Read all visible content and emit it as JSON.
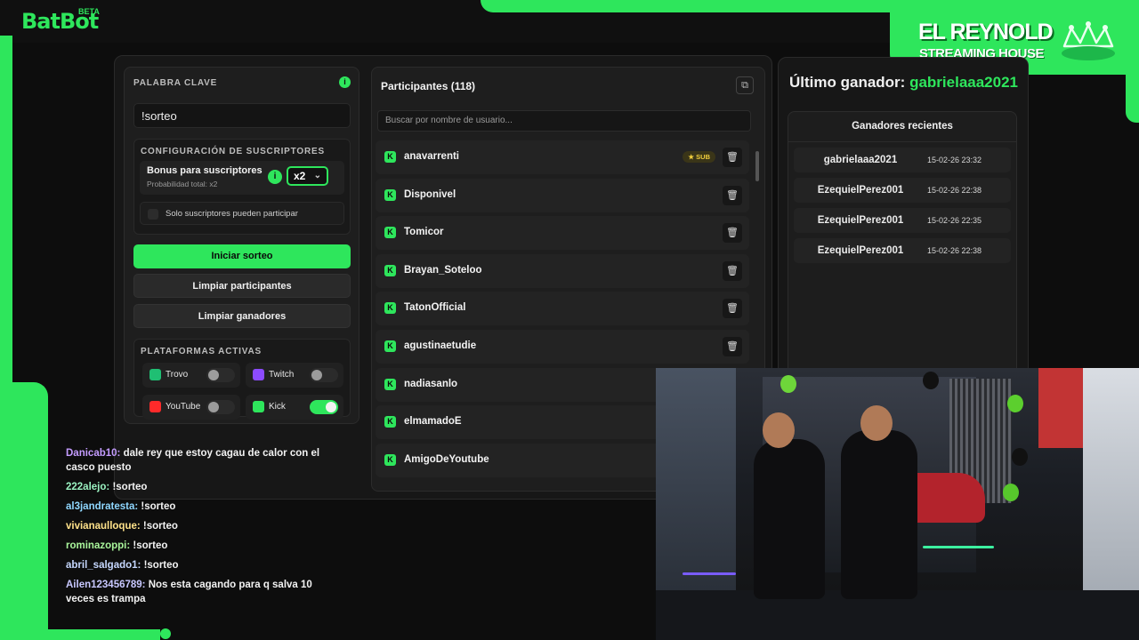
{
  "logo": {
    "text": "BatBot",
    "beta": "BETA"
  },
  "brand": {
    "line1": "EL REYNOLD",
    "line2": "STREAMING HOUSE",
    "crown_icon": "crown-icon"
  },
  "colors": {
    "accent": "#2ee65c",
    "sub_badge": "#f2cf3d"
  },
  "keyword": {
    "label": "PALABRA CLAVE",
    "value": "!sorteo"
  },
  "subs": {
    "label": "CONFIGURACIÓN DE SUSCRIPTORES",
    "bonus_title": "Bonus para suscriptores",
    "bonus_note": "Probabilidad total: x2",
    "multiplier": "x2",
    "only_subs": "Solo suscriptores pueden participar"
  },
  "actions": {
    "start": "Iniciar sorteo",
    "clear_participants": "Limpiar participantes",
    "clear_winners": "Limpiar ganadores"
  },
  "platforms": {
    "label": "PLATAFORMAS ACTIVAS",
    "items": [
      {
        "name": "Trovo",
        "enabled": false
      },
      {
        "name": "Twitch",
        "enabled": false
      },
      {
        "name": "YouTube",
        "enabled": false
      },
      {
        "name": "Kick",
        "enabled": true
      }
    ]
  },
  "participants": {
    "title": "Participantes (118)",
    "search_placeholder": "Buscar por nombre de usuario...",
    "sub_badge": "SUB",
    "rows": [
      {
        "name": "anavarrenti",
        "sub": true
      },
      {
        "name": "Disponivel",
        "sub": false
      },
      {
        "name": "Tomicor",
        "sub": false
      },
      {
        "name": "Brayan_Soteloo",
        "sub": false
      },
      {
        "name": "TatonOfficial",
        "sub": false
      },
      {
        "name": "agustinaetudie",
        "sub": false
      },
      {
        "name": "nadiasanlo",
        "sub": false
      },
      {
        "name": "elmamadoE",
        "sub": false
      },
      {
        "name": "AmigoDeYoutube",
        "sub": false
      }
    ]
  },
  "winners": {
    "last_label": "Último ganador:",
    "last_name": "gabrielaaa2021",
    "recent_title": "Ganadores recientes",
    "rows": [
      {
        "name": "gabrielaaa2021",
        "date": "15-02-26 23:32"
      },
      {
        "name": "EzequielPerez001",
        "date": "15-02-26 22:38"
      },
      {
        "name": "EzequielPerez001",
        "date": "15-02-26 22:35"
      },
      {
        "name": "EzequielPerez001",
        "date": "15-02-26 22:38"
      }
    ]
  },
  "chat": [
    {
      "user": "Danicab10:",
      "msg": "dale rey que estoy cagau de calor con el casco puesto"
    },
    {
      "user": "222alejo:",
      "msg": "!sorteo"
    },
    {
      "user": "al3jandratesta:",
      "msg": "!sorteo"
    },
    {
      "user": "vivianaulloque:",
      "msg": "!sorteo"
    },
    {
      "user": "rominazoppi:",
      "msg": "!sorteo"
    },
    {
      "user": "abril_salgado1:",
      "msg": "!sorteo"
    },
    {
      "user": "Ailen123456789:",
      "msg": "Nos esta cagando para q salva 10 veces es trampa"
    }
  ]
}
